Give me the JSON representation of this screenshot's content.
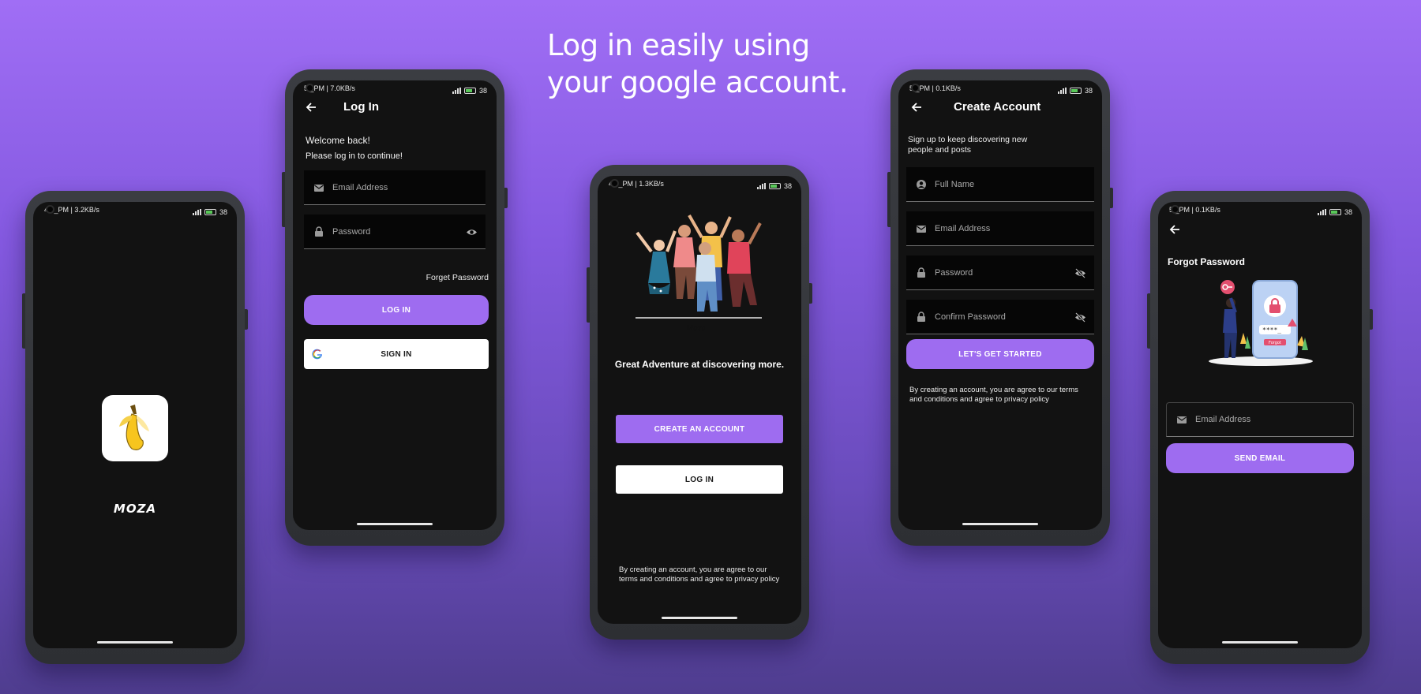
{
  "headline": "Log in easily using your google account.",
  "colors": {
    "accent": "#9e6cf0",
    "screen_bg": "#121212"
  },
  "status_bars": {
    "phone1": {
      "time_speed": "4:5_PM | 3.2KB/s",
      "battery": "38"
    },
    "phone2": {
      "time_speed": "5:_PM | 7.0KB/s",
      "battery": "38"
    },
    "phone3": {
      "time_speed": "4:5_PM | 1.3KB/s",
      "battery": "38"
    },
    "phone4": {
      "time_speed": "5:_PM | 0.1KB/s",
      "battery": "38"
    },
    "phone5": {
      "time_speed": "5:_PM | 0.1KB/s",
      "battery": "38"
    }
  },
  "splash": {
    "app_name": "MOZA",
    "logo_icon": "banana-icon"
  },
  "login": {
    "title": "Log In",
    "welcome": "Welcome back!",
    "prompt": "Please log in to continue!",
    "email_placeholder": "Email Address",
    "password_placeholder": "Password",
    "forget_password": "Forget Password",
    "login_button": "LOG IN",
    "google_button": "SIGN IN"
  },
  "welcome": {
    "tagline": "Great Adventure at discovering more.",
    "create_button": "CREATE AN ACCOUNT",
    "login_button": "LOG IN",
    "terms": "By creating an account, you are agree to our terms and conditions and agree to privacy policy"
  },
  "signup": {
    "title": "Create Account",
    "subtitle": "Sign up to keep discovering new people and posts",
    "full_name_placeholder": "Full Name",
    "email_placeholder": "Email Address",
    "password_placeholder": "Password",
    "confirm_placeholder": "Confirm Password",
    "submit_button": "LET'S GET STARTED",
    "terms": "By creating an account, you are agree to our terms and conditions and agree to privacy policy"
  },
  "forgot": {
    "title": "Forgot Password",
    "email_placeholder": "Email Address",
    "send_button": "SEND EMAIL",
    "illus_pin": "****_",
    "illus_label": "Forgot"
  }
}
